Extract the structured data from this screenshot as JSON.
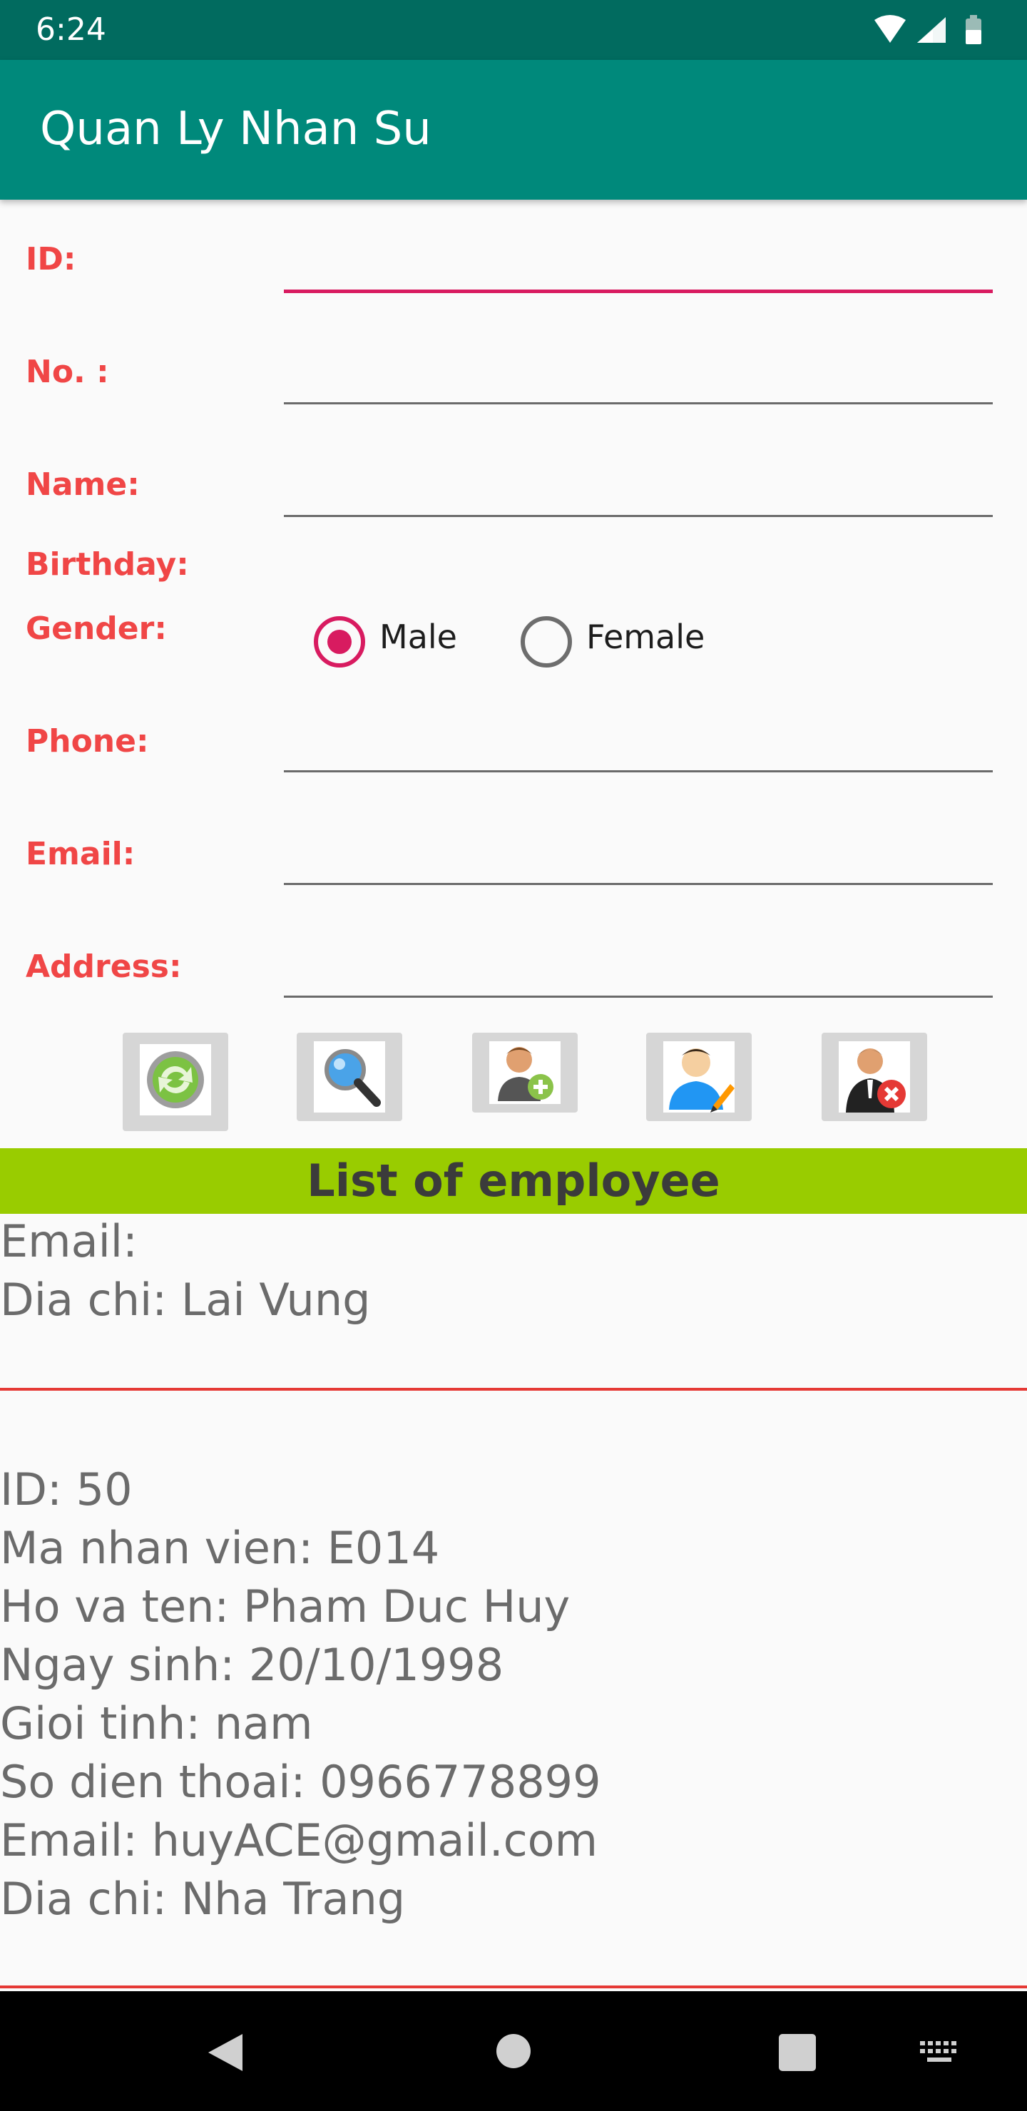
{
  "status_bar": {
    "time": "6:24"
  },
  "app_bar": {
    "title": "Quan Ly Nhan Su"
  },
  "form": {
    "id_label": "ID:",
    "no_label": "No. :",
    "name_label": "Name:",
    "birthday_label": "Birthday:",
    "gender_label": "Gender:",
    "phone_label": "Phone:",
    "email_label": "Email:",
    "address_label": "Address:",
    "gender_options": [
      "Male",
      "Female"
    ],
    "gender_selected": "Male",
    "id_value": "",
    "no_value": "",
    "name_value": "",
    "phone_value": "",
    "email_value": "",
    "address_value": ""
  },
  "toolbar": {
    "buttons": [
      "refresh-icon",
      "search-icon",
      "add-user-icon",
      "edit-user-icon",
      "delete-user-icon"
    ]
  },
  "list": {
    "header": "List of employee",
    "partial_item": {
      "email": "Email:",
      "address": "Dia chi: Lai Vung"
    },
    "item": {
      "id": "ID: 50",
      "code": "Ma nhan vien: E014",
      "name": "Ho va ten: Pham Duc Huy",
      "birthday": "Ngay sinh: 20/10/1998",
      "gender": "Gioi tinh: nam",
      "phone": "So dien thoai: 0966778899",
      "email": "Email: huyACE@gmail.com",
      "address": "Dia chi: Nha Trang"
    }
  },
  "colors": {
    "primary": "#00897b",
    "primary_dark": "#016b5f",
    "accent": "#d81b60",
    "label": "#f04646",
    "list_header": "#99cc00",
    "divider": "#e53935"
  }
}
